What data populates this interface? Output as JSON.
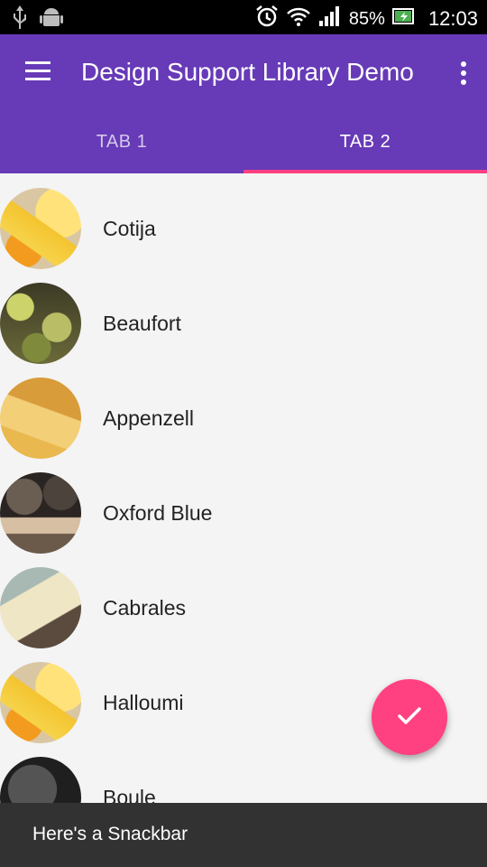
{
  "status_bar": {
    "icons": [
      "usb-icon",
      "android-icon",
      "alarm-icon",
      "wifi-icon",
      "signal-icon",
      "battery-icon"
    ],
    "battery": "85%",
    "time": "12:03"
  },
  "toolbar": {
    "title": "Design Support Library Demo",
    "menu_icon": "hamburger-icon",
    "overflow_icon": "more-vert-icon",
    "color": "#673ab7"
  },
  "tabs": [
    {
      "label": "TAB 1",
      "selected": false
    },
    {
      "label": "TAB 2",
      "selected": true
    }
  ],
  "list": {
    "items": [
      {
        "label": "Cotija"
      },
      {
        "label": "Beaufort"
      },
      {
        "label": "Appenzell"
      },
      {
        "label": "Oxford Blue"
      },
      {
        "label": "Cabrales"
      },
      {
        "label": "Halloumi"
      },
      {
        "label": "Boule"
      }
    ]
  },
  "fab": {
    "icon": "check-icon",
    "color": "#ff4081"
  },
  "snackbar": {
    "text": "Here's a Snackbar"
  }
}
